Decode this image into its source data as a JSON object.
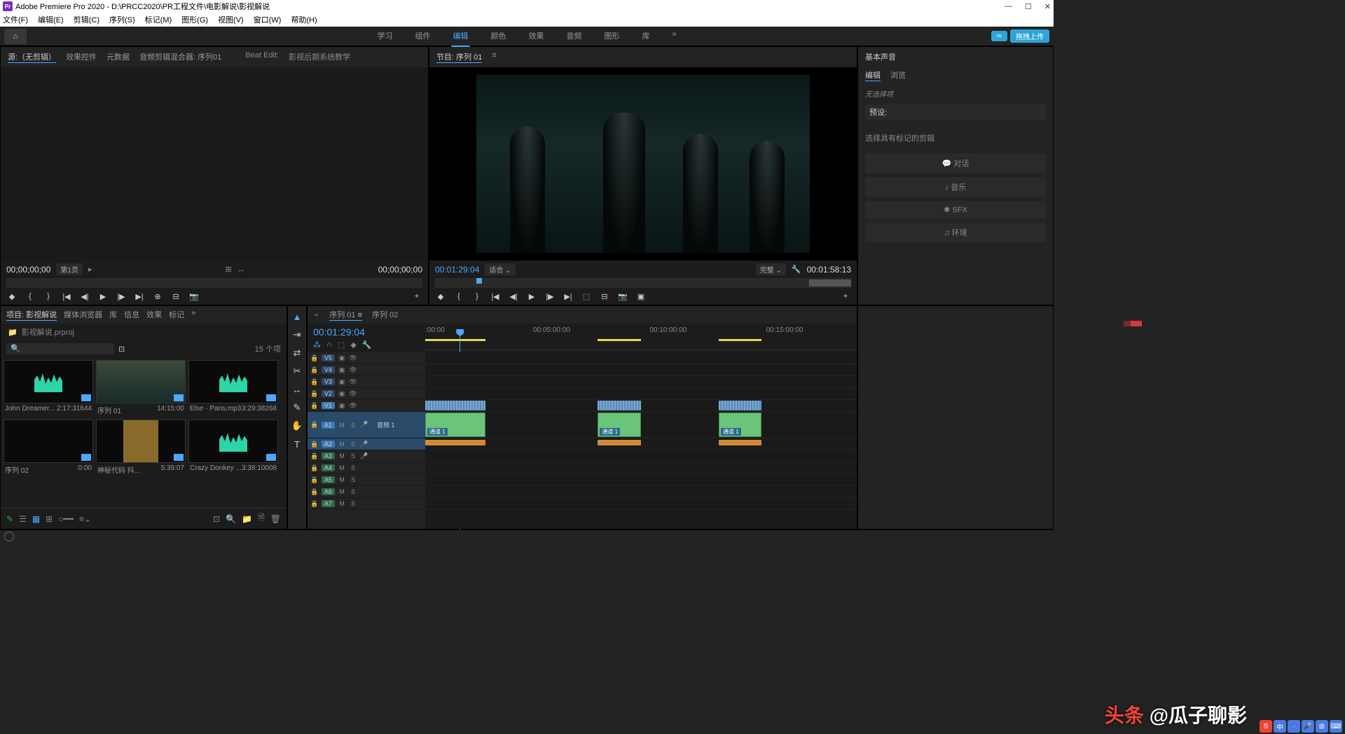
{
  "titlebar": {
    "app": "Adobe Premiere Pro 2020",
    "path": "D:\\PRCC2020\\PR工程文件\\电影解说\\影视解说",
    "icon": "Pr"
  },
  "menu": [
    "文件(F)",
    "编辑(E)",
    "剪辑(C)",
    "序列(S)",
    "标记(M)",
    "图形(G)",
    "视图(V)",
    "窗口(W)",
    "帮助(H)"
  ],
  "workspace": {
    "items": [
      "学习",
      "组件",
      "编辑",
      "颜色",
      "效果",
      "音频",
      "图形",
      "库"
    ],
    "active": "编辑",
    "more": "»",
    "cloud": "拖拽上传"
  },
  "source": {
    "tabs": [
      "源:（无剪辑）",
      "效果控件",
      "元数据",
      "音频剪辑混合器: 序列01"
    ],
    "beat": "Beat Edit:",
    "beatval": "影视后期系统教学",
    "tc": "00;00;00;00",
    "pg": "第1页",
    "tc2": "00;00;00;00"
  },
  "program": {
    "tab": "节目: 序列 01",
    "tc": "00:01:29:04",
    "fit": "适合",
    "full": "完整",
    "dur": "00:01:58:13"
  },
  "project": {
    "tabs": [
      "项目: 影视解说",
      "媒体浏览器",
      "库",
      "信息",
      "效果",
      "标记"
    ],
    "name": "影视解说.prproj",
    "count": "15 个项",
    "bins": [
      {
        "name": "John Dreamer...",
        "dur": "2:17:31644",
        "type": "wave"
      },
      {
        "name": "序列 01",
        "dur": "14:15:00",
        "type": "mov"
      },
      {
        "name": "Else - Paris.mp3",
        "dur": "3:29:38268",
        "type": "wave"
      },
      {
        "name": "序列 02",
        "dur": "0:00",
        "type": "black"
      },
      {
        "name": "神秘代码  抖...",
        "dur": "5:39:07",
        "type": "poster"
      },
      {
        "name": "Crazy Donkey ...",
        "dur": "3:38:10008",
        "type": "wave"
      }
    ]
  },
  "timeline": {
    "tabs": [
      "序列 01",
      "序列 02"
    ],
    "active": "序列 01",
    "tc": "00:01:29:04",
    "ruler": [
      ":00:00",
      "00:05:00:00",
      "00:10:00:00",
      "00:15:00:00"
    ],
    "vtracks": [
      "V5",
      "V4",
      "V3",
      "V2",
      "V1"
    ],
    "a1label": "音频 1",
    "cliplabel": "通道 1",
    "atracks": [
      "A1",
      "A2",
      "A3",
      "A4",
      "A5",
      "A6",
      "A7"
    ]
  },
  "essound": {
    "title": "基本声音",
    "tabs": [
      "编辑",
      "浏览"
    ],
    "nosel": "无选择项",
    "preset": "预设:",
    "msg": "选择具有标记的剪辑",
    "btns": [
      {
        "icon": "💬",
        "t": "对话"
      },
      {
        "icon": "♪",
        "t": "音乐"
      },
      {
        "icon": "✱",
        "t": "SFX"
      },
      {
        "icon": "♫",
        "t": "环境"
      }
    ]
  },
  "watermark": {
    "a": "头条",
    "b": "@瓜子聊影"
  },
  "ime": [
    "S",
    "中",
    "·",
    "🎤",
    "⊞",
    "⌨"
  ]
}
